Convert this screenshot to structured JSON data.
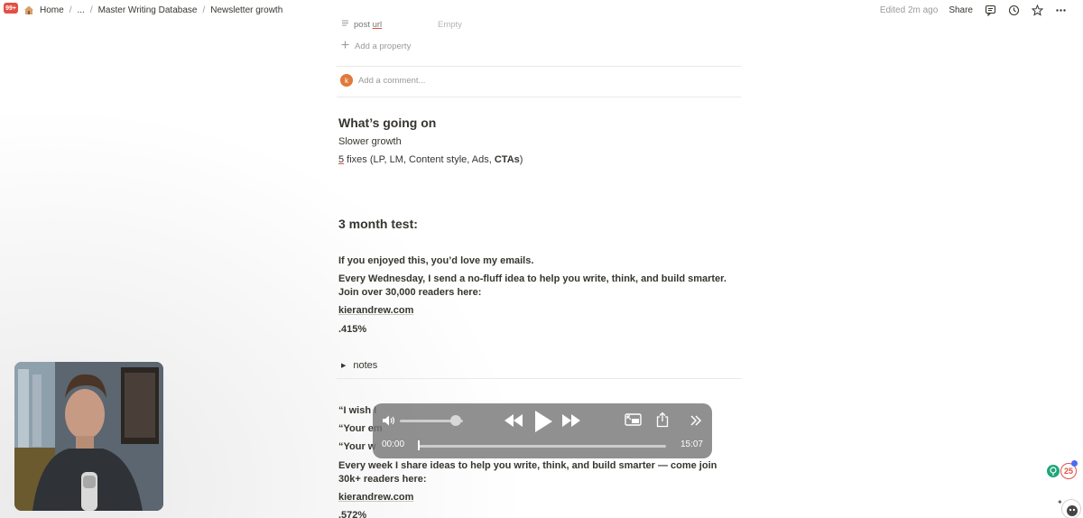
{
  "topbar": {
    "notification_badge": "99+",
    "breadcrumbs": [
      "Home",
      "...",
      "Master Writing Database",
      "Newsletter growth"
    ],
    "edited": "Edited 2m ago",
    "share_label": "Share"
  },
  "properties": {
    "post_url_label_prefix": "post ",
    "post_url_label_suffix": "url",
    "post_url_value": "Empty",
    "add_property": "Add a property"
  },
  "comment": {
    "avatar_initial": "k",
    "placeholder": "Add a comment..."
  },
  "content": {
    "heading_1": "What’s going on",
    "line_1": "Slower growth",
    "line_2_num": "5",
    "line_2_rest": " fixes (LP, LM, Content style, Ads, ",
    "line_2_bold": "CTAs",
    "line_2_end": ")",
    "heading_2": "3 month test:",
    "block1_title": "If you enjoyed this, you’d love my emails.",
    "block1_body": "Every Wednesday, I send a no-fluff idea to help you write, think, and build smarter. Join over 30,000 readers here:",
    "block1_link": "kierandrew.com",
    "block1_rate": ".415%",
    "toggle_label": "notes",
    "quote_1": "“I wish I",
    "quote_2": "“Your em",
    "quote_3": "“Your w",
    "block2_body": "Every week I share ideas to help you write, think, and build smarter — come join 30k+ readers here:",
    "block2_link": "kierandrew.com",
    "block2_rate": ".572%"
  },
  "player": {
    "current_time": "00:00",
    "total_time": "15:07",
    "progress": 0,
    "volume": 0.85
  },
  "widgets": {
    "count_badge": "25"
  }
}
